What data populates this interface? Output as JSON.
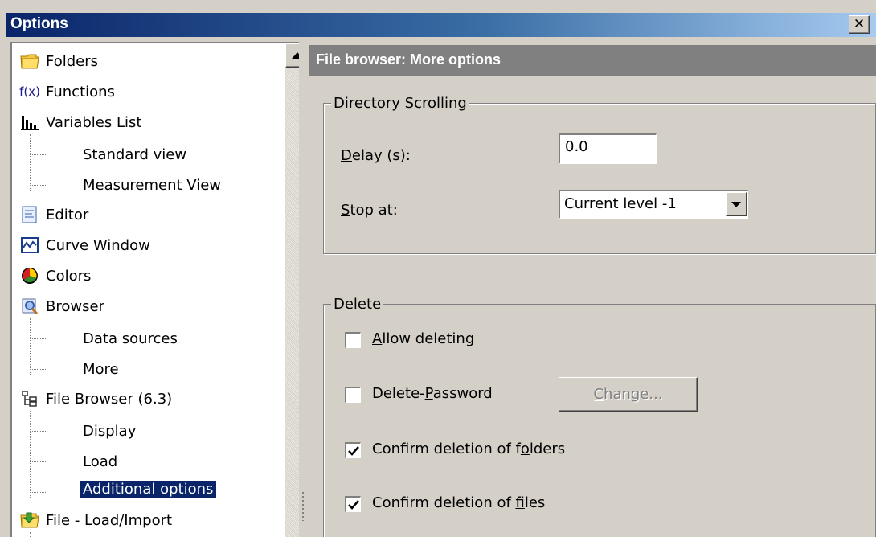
{
  "window": {
    "title": "Options",
    "close_glyph": "✕"
  },
  "tree": {
    "items": [
      {
        "label": "Folders",
        "icon": "folder-icon"
      },
      {
        "label": "Functions",
        "icon": "function-icon"
      },
      {
        "label": "Variables List",
        "icon": "variables-list-icon"
      },
      {
        "label": "Standard view"
      },
      {
        "label": "Measurement View"
      },
      {
        "label": "Editor",
        "icon": "editor-icon"
      },
      {
        "label": "Curve Window",
        "icon": "curve-window-icon"
      },
      {
        "label": "Colors",
        "icon": "colors-icon"
      },
      {
        "label": "Browser",
        "icon": "browser-icon"
      },
      {
        "label": "Data sources"
      },
      {
        "label": "More"
      },
      {
        "label": "File Browser (6.3)",
        "icon": "file-browser-icon"
      },
      {
        "label": "Display"
      },
      {
        "label": "Load"
      },
      {
        "label": "Additional options",
        "selected": true
      },
      {
        "label": "File - Load/Import",
        "icon": "file-load-import-icon"
      }
    ],
    "function_icon_text": "f(x)"
  },
  "panel": {
    "header": "File browser: More options",
    "directory_scrolling": {
      "group_label": "Directory Scrolling",
      "delay_label_u": "D",
      "delay_label_rest": "elay (s):",
      "delay_value": "0.0",
      "stop_label_u": "S",
      "stop_label_rest": "top at:",
      "stop_value": "Current level -1"
    },
    "delete": {
      "group_label": "Delete",
      "allow_u": "A",
      "allow_rest": "llow deleting",
      "allow_checked": false,
      "password_pre": "Delete-",
      "password_u": "P",
      "password_rest": "assword",
      "password_checked": false,
      "change_u": "C",
      "change_rest": "hange...",
      "folders_pre": "Confirm deletion of f",
      "folders_u": "o",
      "folders_rest": "lders",
      "folders_checked": true,
      "files_pre": "Confirm deletion of ",
      "files_u": "f",
      "files_rest": "iles",
      "files_checked": true
    }
  }
}
